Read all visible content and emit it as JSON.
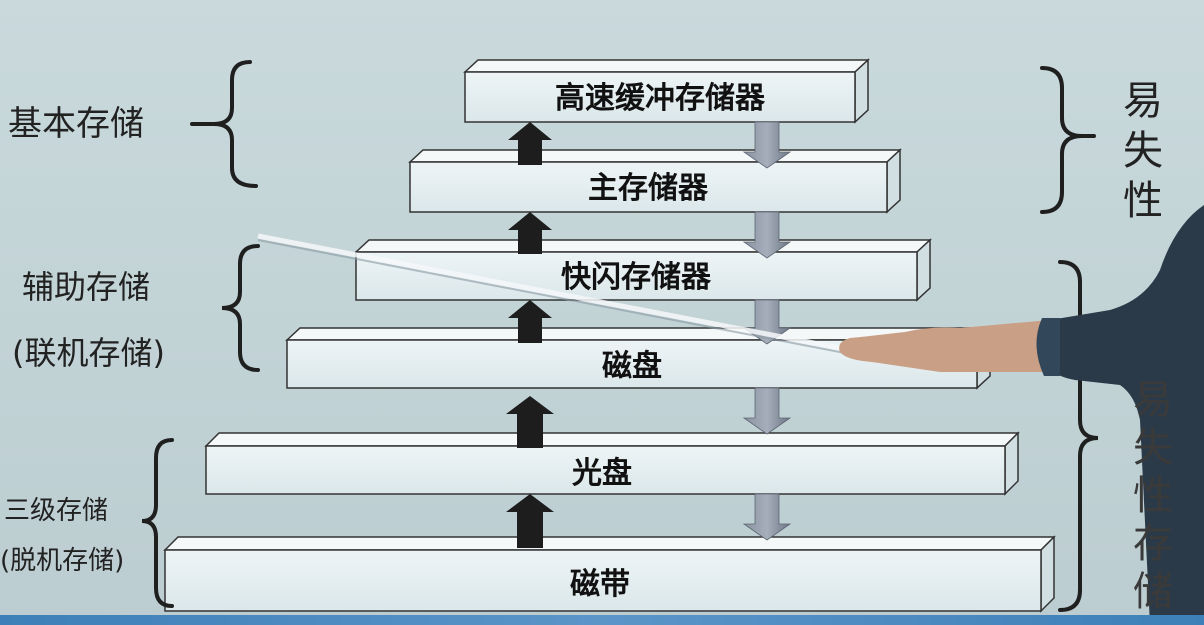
{
  "levels": [
    {
      "label": "高速缓冲存储器"
    },
    {
      "label": "主存储器"
    },
    {
      "label": "快闪存储器"
    },
    {
      "label": "磁盘"
    },
    {
      "label": "光盘"
    },
    {
      "label": "磁带"
    }
  ],
  "left_groups": {
    "basic": "基本存储",
    "auxiliary_line1": "辅助存储",
    "auxiliary_line2": "(联机存储)",
    "tertiary_line1": "三级存储",
    "tertiary_line2": "(脱机存储)"
  },
  "right_groups": {
    "volatile_chars": [
      "易",
      "失",
      "性"
    ],
    "nonvolatile_chars": [
      "易",
      "失",
      "性",
      "存",
      "储"
    ]
  },
  "colors": {
    "bar_front": "#e8f1f3",
    "bar_top": "#f4f8f9",
    "bar_side": "#d4e0e3",
    "up_arrow": "#1d1d1d",
    "down_arrow": "#7b8594"
  }
}
